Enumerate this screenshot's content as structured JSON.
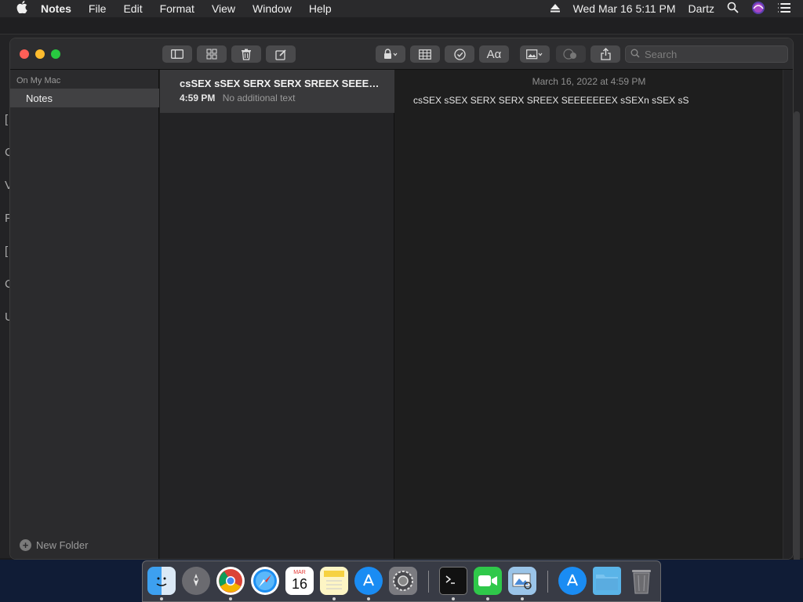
{
  "menubar": {
    "app_name": "Notes",
    "items": [
      "File",
      "Edit",
      "Format",
      "View",
      "Window",
      "Help"
    ],
    "datetime": "Wed Mar 16  5:11 PM",
    "user": "Dartz"
  },
  "background": {
    "left_letters": [
      "[",
      "C",
      "V",
      "F",
      "[",
      "C",
      "U"
    ]
  },
  "toolbar": {
    "search_placeholder": "Search",
    "text_style_label": "Aα"
  },
  "sidebar": {
    "section_title": "On My Mac",
    "folders": [
      {
        "label": "Notes"
      }
    ],
    "new_folder_label": "New Folder"
  },
  "note_list": {
    "notes": [
      {
        "title": "csSEX sSEX SERX SERX SREEX SEEEE...",
        "time": "4:59 PM",
        "preview": "No additional text"
      }
    ]
  },
  "editor": {
    "date": "March 16, 2022 at 4:59 PM",
    "body": "csSEX sSEX SERX SERX SREEX SEEEEEEEX sSEXn sSEX sS"
  },
  "dock": {
    "calendar_month": "MAR",
    "calendar_day": "16",
    "items": [
      "finder",
      "launchpad",
      "chrome",
      "safari",
      "calendar",
      "notes",
      "app-store",
      "system-preferences",
      "terminal",
      "facetime",
      "preview",
      "app-store-download",
      "downloads-folder",
      "trash"
    ]
  },
  "colors": {
    "close": "#fe5f57",
    "minimize": "#febc2e",
    "zoom": "#28c840",
    "selection": "#414143"
  }
}
